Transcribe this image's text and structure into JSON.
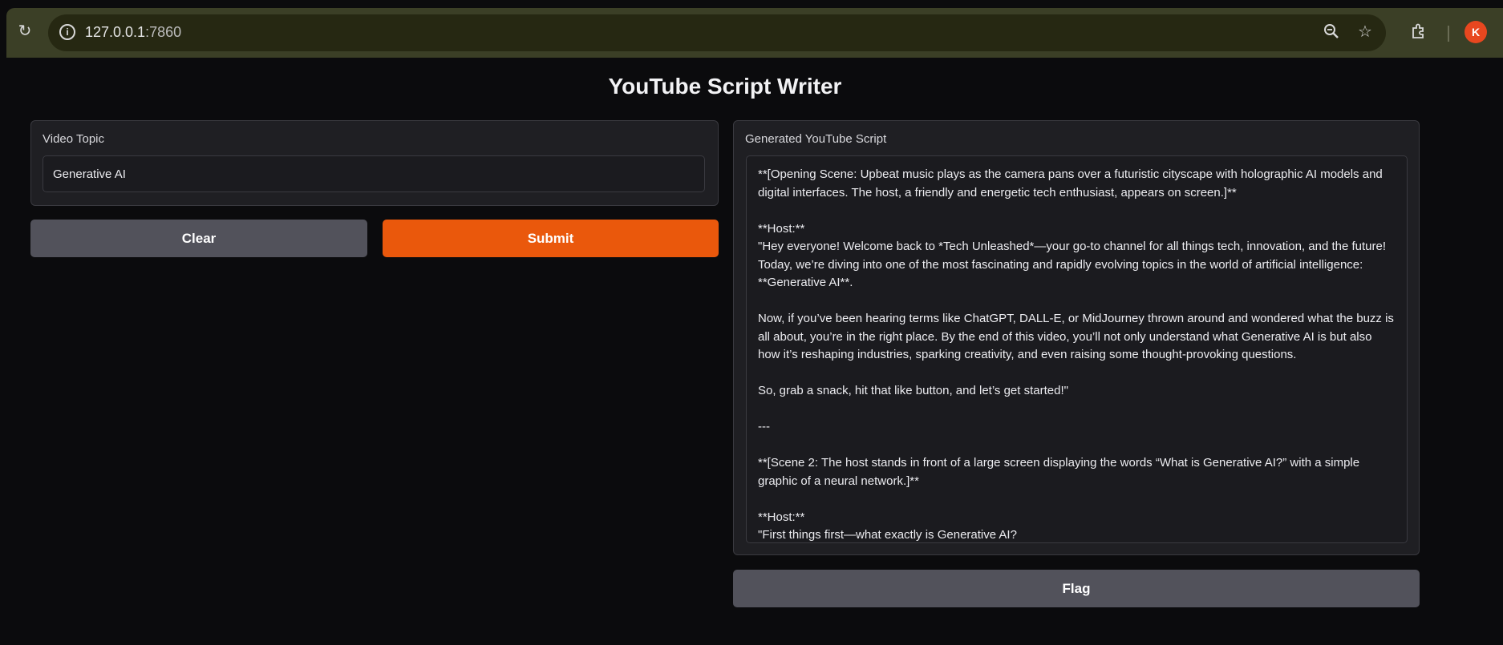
{
  "browser": {
    "url_host": "127.0.0.1",
    "url_port": ":7860",
    "avatar_letter": "K",
    "icons": {
      "reload": "reload-icon",
      "info": "info-icon",
      "zoom": "zoom-icon",
      "star": "star-icon",
      "extensions": "extensions-icon"
    },
    "avatar_color": "#e8471f"
  },
  "app": {
    "title": "YouTube Script Writer",
    "topic": {
      "label": "Video Topic",
      "value": "Generative AI"
    },
    "buttons": {
      "clear": "Clear",
      "submit": "Submit",
      "flag": "Flag"
    },
    "output": {
      "label": "Generated YouTube Script",
      "lines": [
        "**[Opening Scene: Upbeat music plays as the camera pans over a futuristic cityscape with holographic AI models and digital interfaces. The host, a friendly and energetic tech enthusiast, appears on screen.]**",
        "",
        "**Host:**",
        "\"Hey everyone! Welcome back to *Tech Unleashed*—your go-to channel for all things tech, innovation, and the future! Today, we’re diving into one of the most fascinating and rapidly evolving topics in the world of artificial intelligence: **Generative AI**.",
        "",
        "Now, if you’ve been hearing terms like ChatGPT, DALL-E, or MidJourney thrown around and wondered what the buzz is all about, you’re in the right place. By the end of this video, you’ll not only understand what Generative AI is but also how it’s reshaping industries, sparking creativity, and even raising some thought-provoking questions.",
        "",
        "So, grab a snack, hit that like button, and let’s get started!\"",
        "",
        "---",
        "",
        "**[Scene 2: The host stands in front of a large screen displaying the words “What is Generative AI?” with a simple graphic of a neural network.]**",
        "",
        "**Host:**",
        "\"First things first—what exactly is Generative AI?"
      ]
    },
    "colors": {
      "submit": "#ea580c",
      "secondary": "#52525b",
      "background": "#0b0b0d",
      "panel": "#1f1f23"
    }
  }
}
